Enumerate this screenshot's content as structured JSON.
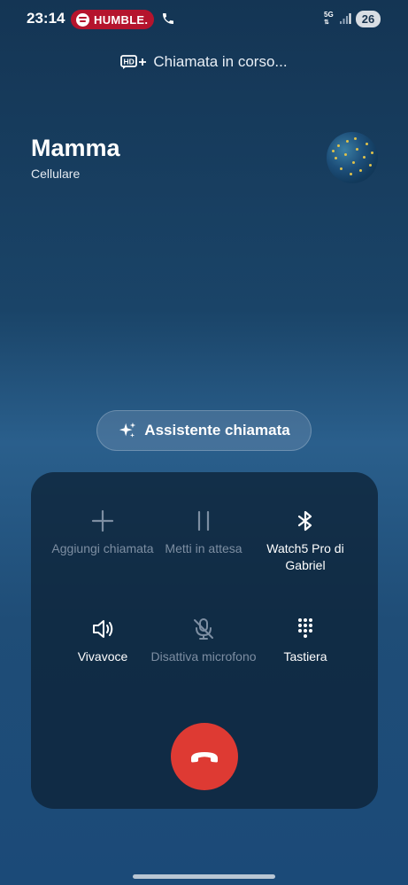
{
  "status_bar": {
    "time": "23:14",
    "media_chip": "HUMBLE.",
    "network": "5G",
    "battery": "26"
  },
  "call": {
    "status": "Chiamata in corso...",
    "contact_name": "Mamma",
    "contact_type": "Cellulare"
  },
  "assistant": {
    "label": "Assistente chiamata"
  },
  "controls": {
    "add_call": "Aggiungi chiamata",
    "hold": "Metti in attesa",
    "bluetooth": "Watch5 Pro di Gabriel",
    "speaker": "Vivavoce",
    "mute": "Disattiva microfono",
    "keypad": "Tastiera"
  },
  "icons": {
    "hd": "hd-plus-icon",
    "sparkle": "sparkle-icon",
    "end_call": "end-call-icon"
  },
  "colors": {
    "end_call": "#de3a33",
    "spotify_chip": "#b5142d"
  }
}
